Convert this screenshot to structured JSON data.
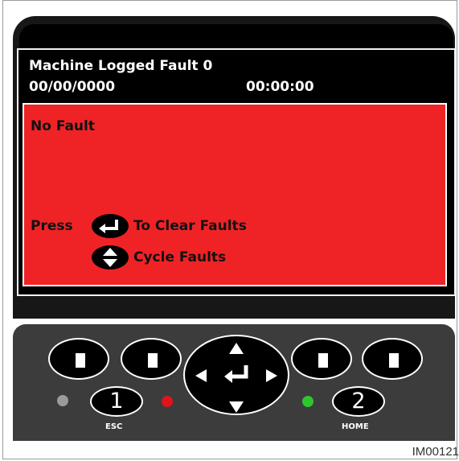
{
  "display": {
    "title": "Machine Logged Fault 0",
    "date": "00/00/0000",
    "time": "00:00:00",
    "fault_text": "No Fault",
    "press_label": "Press",
    "clear_faults_label": "To Clear Faults",
    "cycle_faults_label": "Cycle Faults",
    "panel_color": "#ef2326"
  },
  "keypad": {
    "key1_label": "1",
    "key1_sub": "ESC",
    "key2_label": "2",
    "key2_sub": "HOME",
    "led_colors": {
      "left": "#9a9a9a",
      "middle": "#e0141a",
      "right": "#2fc52f"
    }
  },
  "figure_id": "IM00121"
}
